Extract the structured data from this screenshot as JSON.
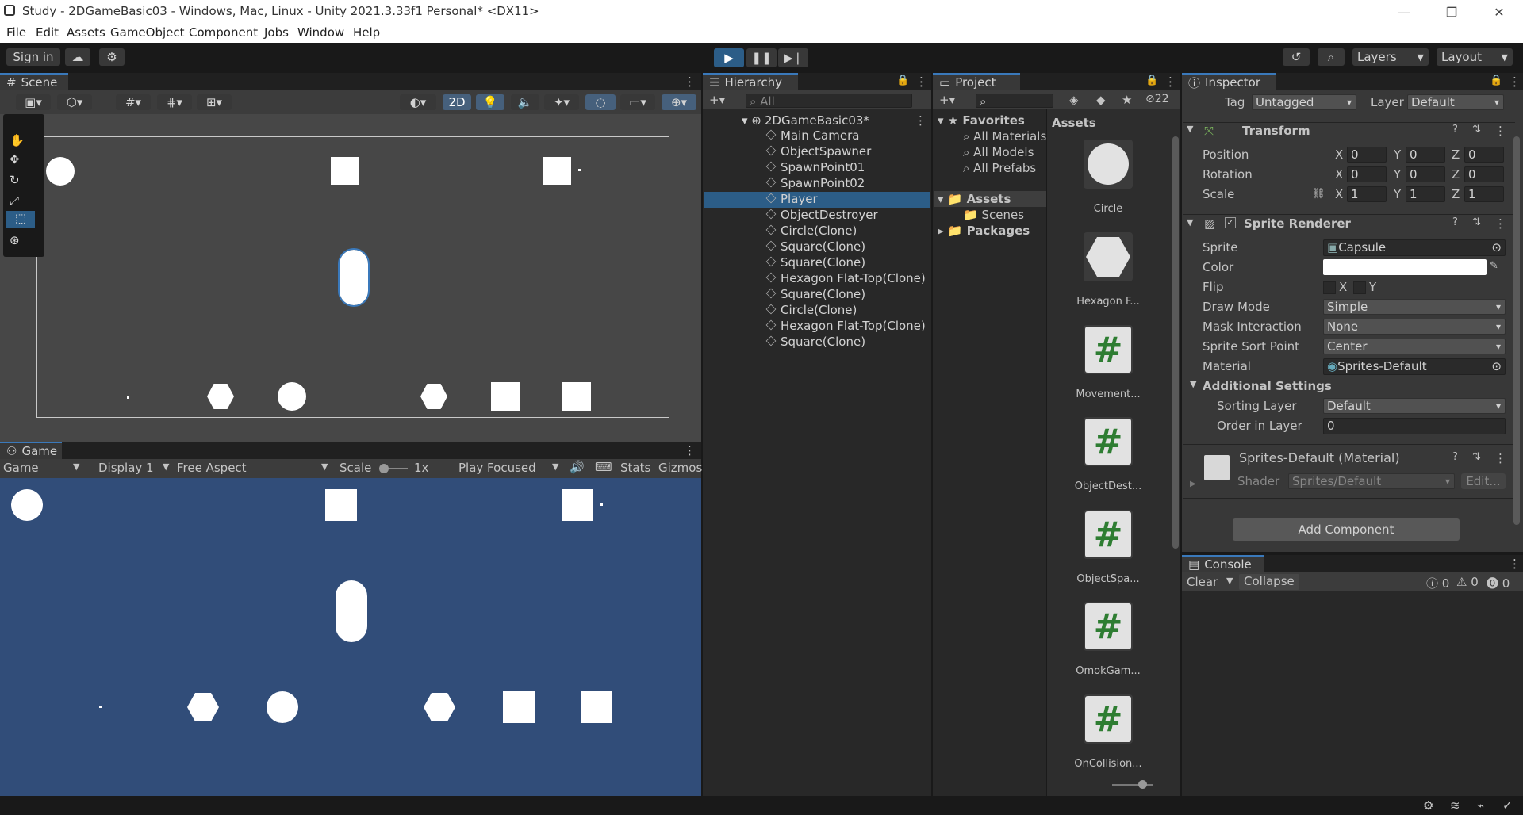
{
  "window": {
    "title": "Study - 2DGameBasic03 - Windows, Mac, Linux - Unity 2021.3.33f1 Personal* <DX11>"
  },
  "menu": [
    "File",
    "Edit",
    "Assets",
    "GameObject",
    "Component",
    "Jobs",
    "Window",
    "Help"
  ],
  "toolbar": {
    "sign_in": "Sign in",
    "layers": "Layers",
    "layout": "Layout"
  },
  "scene": {
    "tab": "Scene",
    "mode2d": "2D"
  },
  "game": {
    "tab": "Game",
    "view": "Game",
    "display": "Display 1",
    "aspect": "Free Aspect",
    "scale_label": "Scale",
    "scale_value": "1x",
    "play_mode": "Play Focused",
    "stats": "Stats",
    "gizmos": "Gizmos"
  },
  "hierarchy": {
    "tab": "Hierarchy",
    "search_placeholder": "All",
    "scene_name": "2DGameBasic03*",
    "items": [
      "Main Camera",
      "ObjectSpawner",
      "SpawnPoint01",
      "SpawnPoint02",
      "Player",
      "ObjectDestroyer",
      "Circle(Clone)",
      "Square(Clone)",
      "Square(Clone)",
      "Hexagon Flat-Top(Clone)",
      "Square(Clone)",
      "Circle(Clone)",
      "Hexagon Flat-Top(Clone)",
      "Square(Clone)"
    ],
    "selected": "Player"
  },
  "project": {
    "tab": "Project",
    "hidden_count": "22",
    "favorites": "Favorites",
    "fav_items": [
      "All Materials",
      "All Models",
      "All Prefabs"
    ],
    "assets": "Assets",
    "scenes": "Scenes",
    "packages": "Packages",
    "assets_header": "Assets",
    "asset_items": [
      "Circle",
      "Hexagon F...",
      "Movement...",
      "ObjectDest...",
      "ObjectSpa...",
      "OmokGam...",
      "OnCollision..."
    ]
  },
  "inspector": {
    "tab": "Inspector",
    "tag_label": "Tag",
    "tag_value": "Untagged",
    "layer_label": "Layer",
    "layer_value": "Default",
    "transform": "Transform",
    "position": "Position",
    "rotation": "Rotation",
    "scale": "Scale",
    "pos": [
      "0",
      "0",
      "0"
    ],
    "rot": [
      "0",
      "0",
      "0"
    ],
    "scl": [
      "1",
      "1",
      "1"
    ],
    "x": "X",
    "y": "Y",
    "z": "Z",
    "sprite_renderer": "Sprite Renderer",
    "sprite_label": "Sprite",
    "sprite_value": "Capsule",
    "color_label": "Color",
    "flip_label": "Flip",
    "draw_mode_label": "Draw Mode",
    "draw_mode_value": "Simple",
    "mask_label": "Mask Interaction",
    "mask_value": "None",
    "sort_point_label": "Sprite Sort Point",
    "sort_point_value": "Center",
    "material_label": "Material",
    "material_value": "Sprites-Default",
    "additional": "Additional Settings",
    "sorting_layer_label": "Sorting Layer",
    "sorting_layer_value": "Default",
    "order_label": "Order in Layer",
    "order_value": "0",
    "material_name": "Sprites-Default (Material)",
    "shader_label": "Shader",
    "shader_value": "Sprites/Default",
    "edit": "Edit...",
    "add_component": "Add Component"
  },
  "console": {
    "tab": "Console",
    "clear": "Clear",
    "collapse": "Collapse",
    "logs": "0",
    "warnings": "0",
    "errors": "0"
  },
  "colors": {
    "accent": "#3a79bb",
    "game_bg": "#314d79",
    "scene_bg": "#474747",
    "selection": "#2c5d87"
  }
}
